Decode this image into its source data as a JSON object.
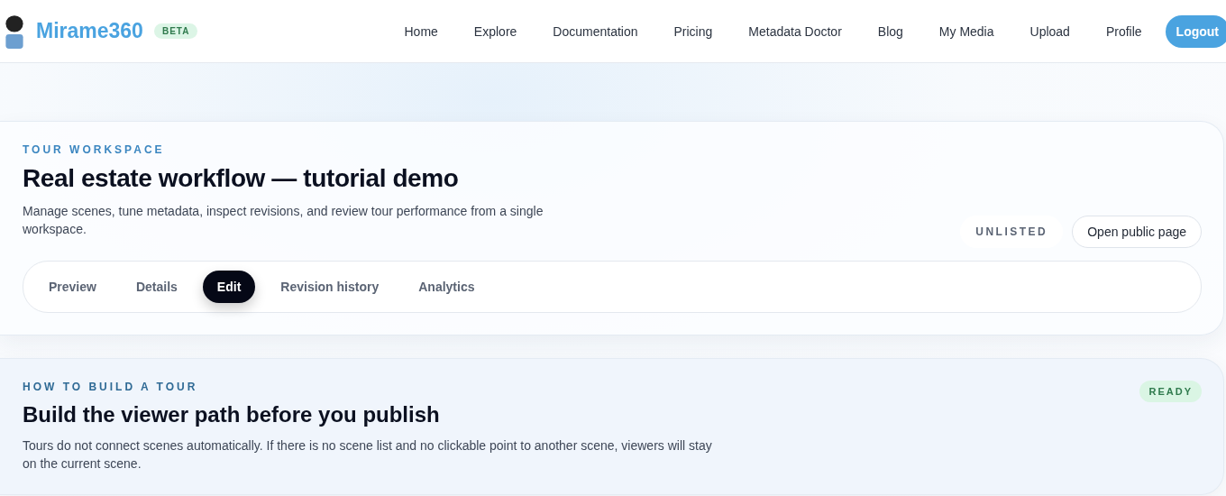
{
  "brand": {
    "name": "Mirame360",
    "badge": "BETA"
  },
  "nav": [
    {
      "label": "Home",
      "kind": "link"
    },
    {
      "label": "Explore",
      "kind": "link"
    },
    {
      "label": "Documentation",
      "kind": "link"
    },
    {
      "label": "Pricing",
      "kind": "link"
    },
    {
      "label": "Metadata Doctor",
      "kind": "link"
    },
    {
      "label": "Blog",
      "kind": "link"
    },
    {
      "label": "My Media",
      "kind": "link"
    },
    {
      "label": "Upload",
      "kind": "link"
    },
    {
      "label": "Profile",
      "kind": "link"
    },
    {
      "label": "Logout",
      "kind": "primary"
    }
  ],
  "workspace": {
    "eyebrow": "TOUR WORKSPACE",
    "title": "Real estate workflow — tutorial demo",
    "description": "Manage scenes, tune metadata, inspect revisions, and review tour performance from a single workspace.",
    "visibility": "UNLISTED",
    "action": "Open public page",
    "tabs": [
      {
        "label": "Preview",
        "selected": false
      },
      {
        "label": "Details",
        "selected": false
      },
      {
        "label": "Edit",
        "selected": true
      },
      {
        "label": "Revision history",
        "selected": false
      },
      {
        "label": "Analytics",
        "selected": false
      }
    ]
  },
  "guide": {
    "eyebrow": "HOW TO BUILD A TOUR",
    "title": "Build the viewer path before you publish",
    "description": "Tours do not connect scenes automatically. If there is no scene list and no clickable point to another scene, viewers will stay on the current scene.",
    "status": "READY"
  }
}
